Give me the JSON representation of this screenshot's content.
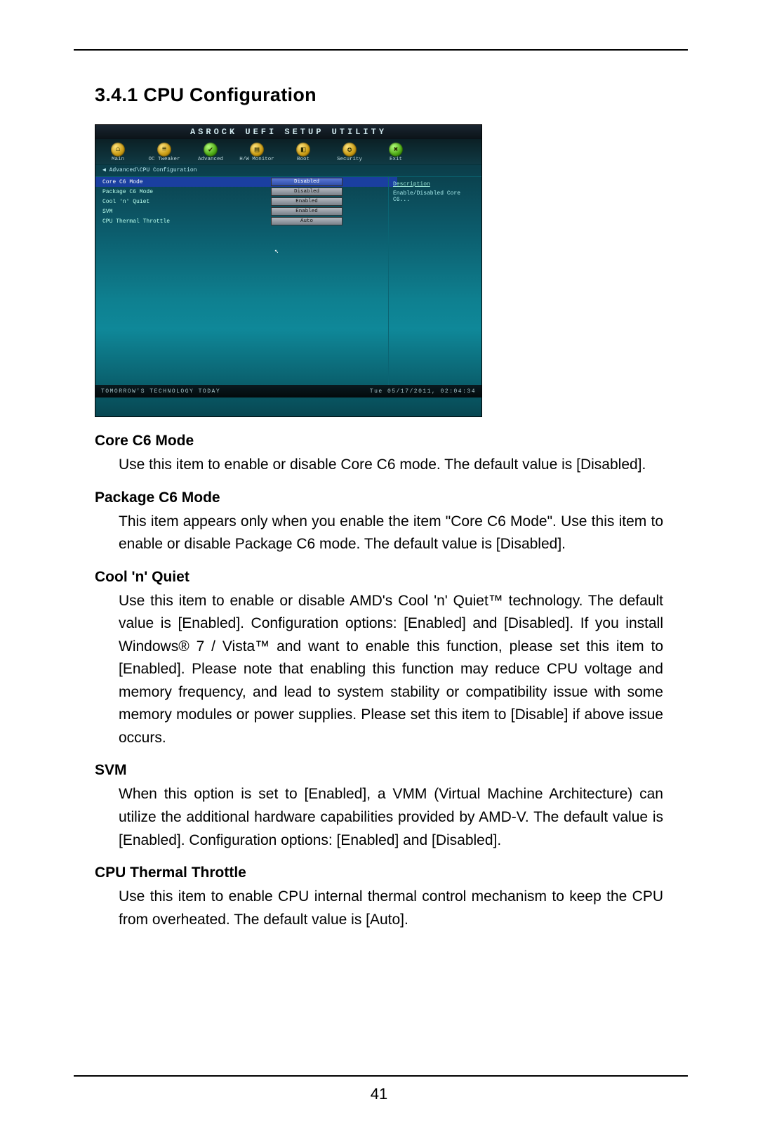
{
  "section_title": "3.4.1  CPU Configuration",
  "page_number": "41",
  "bios": {
    "header": "ASROCK UEFI SETUP UTILITY",
    "nav": [
      {
        "icon": "home",
        "label": "Main"
      },
      {
        "icon": "tweak",
        "label": "OC Tweaker"
      },
      {
        "icon": "advanced",
        "label": "Advanced"
      },
      {
        "icon": "hw",
        "label": "H/W Monitor"
      },
      {
        "icon": "boot",
        "label": "Boot"
      },
      {
        "icon": "security",
        "label": "Security"
      },
      {
        "icon": "exit",
        "label": "Exit"
      }
    ],
    "breadcrumb": "◀  Advanced\\CPU Configuration",
    "right_header": "Description",
    "right_text": "Enable/Disabled Core C6...",
    "rows": [
      {
        "k": "Core C6 Mode",
        "v": "Disabled",
        "selected": true
      },
      {
        "k": "Package C6 Mode",
        "v": "Disabled",
        "selected": false
      },
      {
        "k": "Cool 'n' Quiet",
        "v": "Enabled",
        "selected": false
      },
      {
        "k": "SVM",
        "v": "Enabled",
        "selected": false
      },
      {
        "k": "CPU Thermal Throttle",
        "v": "Auto",
        "selected": false
      }
    ],
    "footer_left": "TOMORROW'S TECHNOLOGY TODAY",
    "footer_right": "Tue 05/17/2011, 02:04:34"
  },
  "options": [
    {
      "title": "Core C6 Mode",
      "desc": "Use this item to enable or disable Core C6 mode. The default value is [Disabled]."
    },
    {
      "title": "Package C6 Mode",
      "desc": "This item appears only when you enable the item \"Core C6 Mode\". Use this item to enable or disable Package C6 mode. The default value is [Disabled]."
    },
    {
      "title": "Cool 'n' Quiet",
      "desc": "Use this item to enable or disable AMD's Cool 'n' Quiet™ technology. The default value is [Enabled]. Configuration options: [Enabled] and [Disabled]. If you install Windows® 7 / Vista™ and want to enable this function, please set this item to [Enabled]. Please note that enabling this function may reduce CPU voltage and memory frequency, and lead to system stability or compatibility issue with some memory modules or power supplies. Please set this item to [Disable] if above issue occurs."
    },
    {
      "title": "SVM",
      "desc": "When this option is set to [Enabled], a VMM (Virtual Machine Architecture) can utilize the additional hardware capabilities provided by AMD-V. The default value is [Enabled]. Configuration options: [Enabled] and [Disabled]."
    },
    {
      "title": "CPU Thermal Throttle",
      "desc": "Use this item to enable CPU internal thermal control mechanism to keep the CPU from overheated. The default value is [Auto]."
    }
  ]
}
